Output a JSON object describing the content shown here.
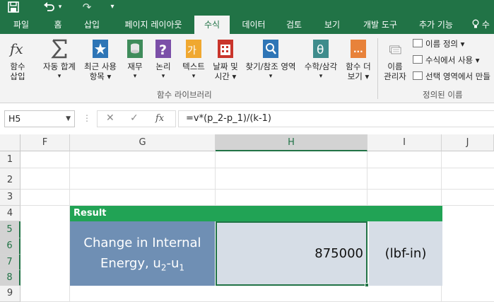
{
  "qat": {
    "redo_label": "↷",
    "customize_label": "▾"
  },
  "tabs": [
    {
      "label": "파일",
      "active": false
    },
    {
      "label": "홈",
      "active": false
    },
    {
      "label": "삽입",
      "active": false
    },
    {
      "label": "페이지 레이아웃",
      "active": false
    },
    {
      "label": "수식",
      "active": true
    },
    {
      "label": "데이터",
      "active": false
    },
    {
      "label": "검토",
      "active": false
    },
    {
      "label": "보기",
      "active": false
    },
    {
      "label": "개발 도구",
      "active": false
    },
    {
      "label": "추가 기능",
      "active": false
    }
  ],
  "tell_me": "수",
  "ribbon": {
    "insert_function": {
      "line1": "함수",
      "line2": "삽입"
    },
    "autosum": {
      "line1": "자동 합계",
      "line2": "▾"
    },
    "recent": {
      "line1": "최근 사용",
      "line2": "항목 ▾"
    },
    "financial": {
      "line1": "재무",
      "line2": "▾"
    },
    "logical": {
      "line1": "논리",
      "line2": "▾"
    },
    "text": {
      "line1": "텍스트",
      "line2": "▾"
    },
    "datetime": {
      "line1": "날짜 및",
      "line2": "시간 ▾"
    },
    "lookup": {
      "line1": "찾기/참조 영역",
      "line2": "▾"
    },
    "math": {
      "line1": "수학/삼각",
      "line2": "▾"
    },
    "more": {
      "line1": "함수 더",
      "line2": "보기 ▾"
    },
    "library_group": "함수 라이브러리",
    "name_manager": {
      "line1": "이름",
      "line2": "관리자"
    },
    "define_name": "이름 정의 ▾",
    "use_in_formula": "수식에서 사용 ▾",
    "create_from_selection": "선택 영역에서 만들",
    "defined_names_group": "정의된 이름"
  },
  "formula_bar": {
    "name_box": "H5",
    "cancel": "✕",
    "enter": "✓",
    "fx": "fx",
    "formula": "=v*(p_2-p_1)/(k-1)"
  },
  "columns": [
    "F",
    "G",
    "H",
    "I",
    "J"
  ],
  "rows": [
    "1",
    "2",
    "3",
    "4",
    "5",
    "6",
    "7",
    "8",
    "9"
  ],
  "result": {
    "header": "Result",
    "label_line1": "Change in Internal",
    "label_line2_pre": "Energy, u",
    "label_sub1": "2",
    "label_mid": "-u",
    "label_sub2": "1",
    "value": "875000",
    "unit": "(lbf-in)"
  }
}
